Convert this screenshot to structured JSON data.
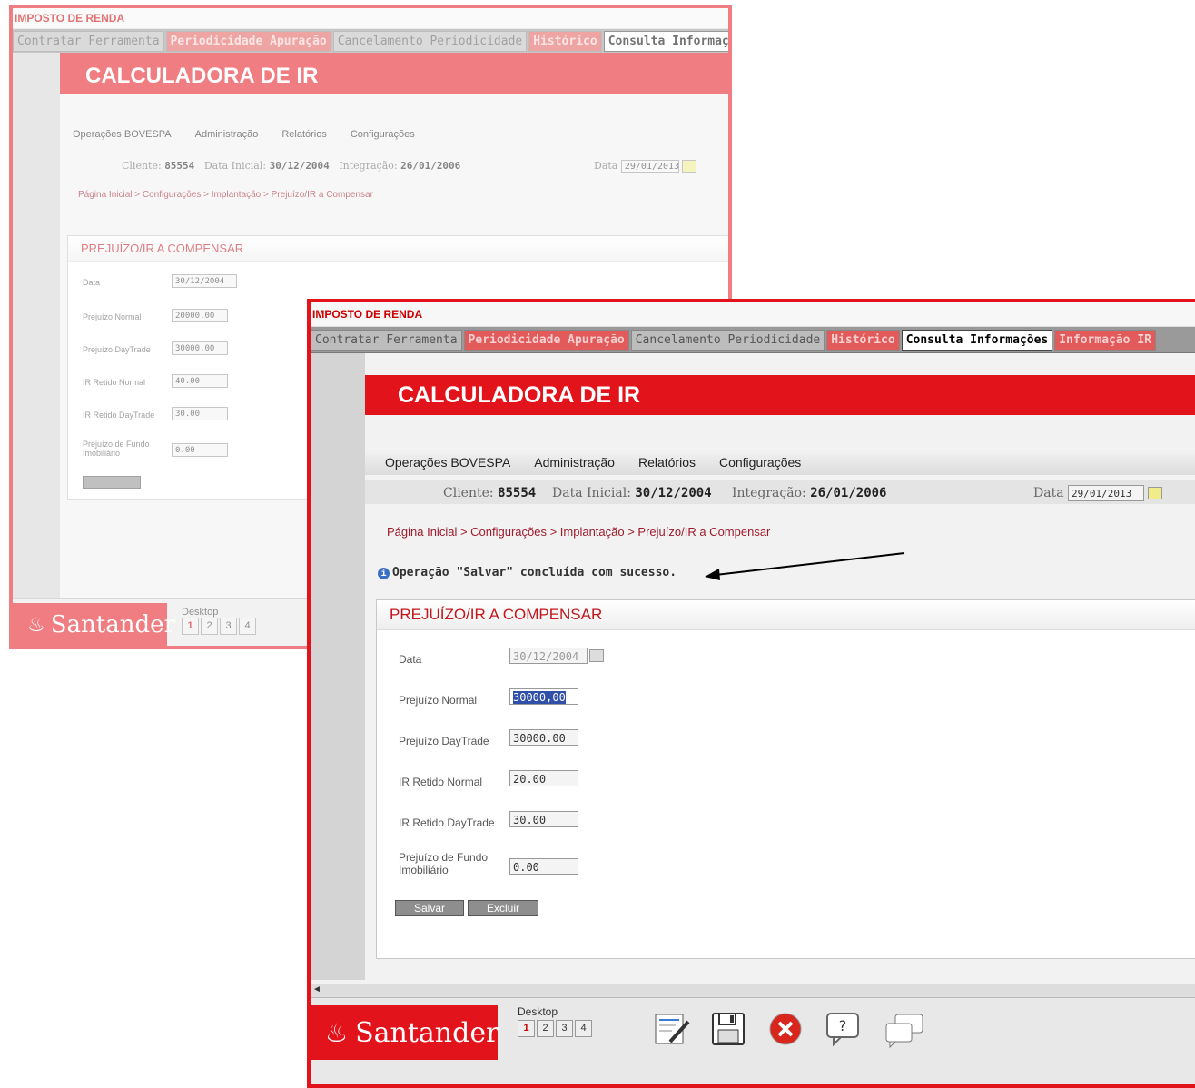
{
  "title": "IMPOSTO DE RENDA",
  "tabs": [
    {
      "label": "Contratar Ferramenta",
      "style": "normal"
    },
    {
      "label": "Periodicidade Apuração",
      "style": "red"
    },
    {
      "label": "Cancelamento Periodicidade",
      "style": "normal"
    },
    {
      "label": "Histórico",
      "style": "red"
    },
    {
      "label": "Consulta Informações",
      "style": "active"
    },
    {
      "label": "Informação IR",
      "style": "red"
    }
  ],
  "banner": "CALCULADORA DE IR",
  "menu": [
    "Operações BOVESPA",
    "Administração",
    "Relatórios",
    "Configurações"
  ],
  "info": {
    "cliente_label": "Cliente:",
    "cliente": "85554",
    "data_inicial_label": "Data Inicial:",
    "data_inicial": "30/12/2004",
    "integracao_label": "Integração:",
    "integracao": "26/01/2006",
    "data_label": "Data",
    "data": "29/01/2013"
  },
  "breadcrumb": "Página Inicial > Configurações > Implantação > Prejuízo/IR a Compensar",
  "message": "Operação \"Salvar\" concluída com sucesso.",
  "panel_title": "PREJUÍZO/IR A COMPENSAR",
  "fields": [
    {
      "label": "Data",
      "value": "30/12/2004"
    },
    {
      "label": "Prejuízo Normal",
      "value": "30000,00"
    },
    {
      "label": "Prejuízo DayTrade",
      "value": "30000.00"
    },
    {
      "label": "IR Retido Normal",
      "value": "20.00"
    },
    {
      "label": "IR Retido DayTrade",
      "value": "30.00"
    },
    {
      "label": "Prejuízo de Fundo Imobiliário",
      "value": "0.00"
    }
  ],
  "buttons": {
    "save": "Salvar",
    "delete": "Excluir"
  },
  "taskbar": {
    "brand": "Santander",
    "desktop_label": "Desktop",
    "desktops": [
      "1",
      "2",
      "3",
      "4"
    ]
  },
  "back_fields": [
    {
      "label": "Data",
      "value": "30/12/2004"
    },
    {
      "label": "Prejuízo Normal",
      "value": "20000.00"
    },
    {
      "label": "Prejuízo DayTrade",
      "value": "30000.00"
    },
    {
      "label": "IR Retido Normal",
      "value": "40.00"
    },
    {
      "label": "IR Retido DayTrade",
      "value": "30.00"
    },
    {
      "label": "Prejuízo de Fundo Imobiliário",
      "value": "0.00"
    }
  ]
}
